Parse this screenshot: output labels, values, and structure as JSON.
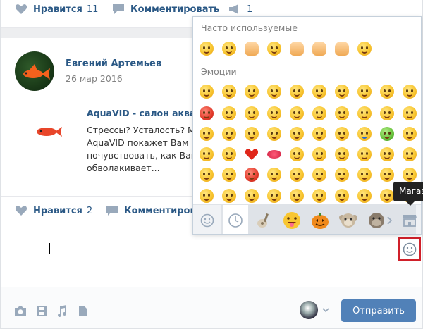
{
  "post_top": {
    "like_label": "Нравится",
    "like_count": "11",
    "comment_label": "Комментировать",
    "share_count": "1"
  },
  "post": {
    "author": "Евгений Артемьев",
    "date": "26 мар 2016",
    "link_title": "AquaVID - салон аквар",
    "link_text_lines": [
      "Стрессы? Усталость? М",
      "AquaVID покажет Вам в",
      "почувствовать, как Ваш",
      "обволакивает..."
    ],
    "like_label": "Нравится",
    "like_count": "2",
    "comment_label": "Комментировать"
  },
  "composer": {
    "send_label": "Отправить"
  },
  "emoji_panel": {
    "section_frequent": "Часто используемые",
    "section_emotions": "Эмоции",
    "tooltip": "Магазин"
  },
  "colors": {
    "link": "#2a5885",
    "send_button": "#5181b8",
    "highlight_border": "#d0202a"
  },
  "icons": [
    "heart-icon",
    "comment-icon",
    "share-icon",
    "camera-icon",
    "video-icon",
    "music-icon",
    "document-icon",
    "smile-icon",
    "clock-icon",
    "store-icon",
    "chevron-right-icon",
    "chevron-down-icon"
  ]
}
